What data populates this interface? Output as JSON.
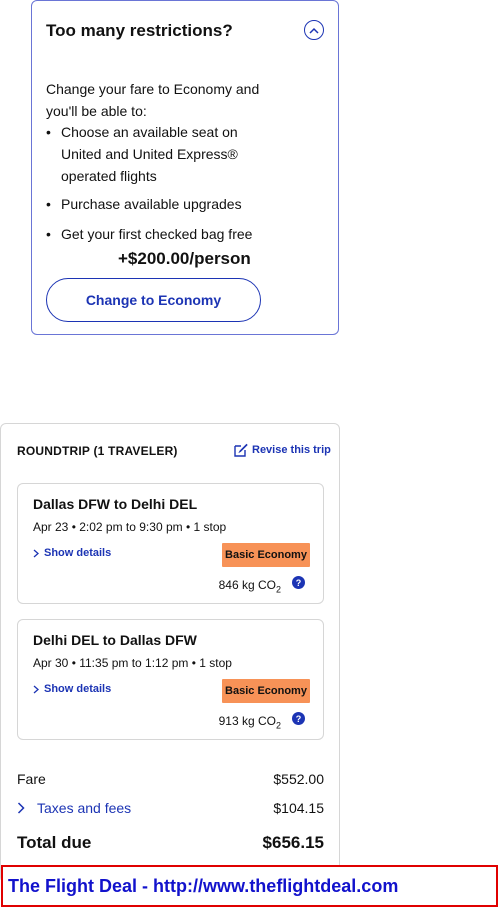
{
  "upsell": {
    "title": "Too many restrictions?",
    "intro": "Change your fare to Economy and you'll be able to:",
    "benefits": [
      "Choose an available seat on United and United Express® operated flights",
      "Purchase available upgrades",
      "Get your first checked bag free"
    ],
    "price": "+$200.00/person",
    "button_label": "Change to Economy"
  },
  "trip": {
    "header": "ROUNDTRIP (1 TRAVELER)",
    "revise_label": "Revise this trip",
    "segments": [
      {
        "route": "Dallas DFW to Delhi DEL",
        "time": "Apr 23 • 2:02 pm to 9:30 pm • 1 stop",
        "details_label": "Show details",
        "fare_class": "Basic Economy",
        "co2_value": "846 kg CO",
        "co2_sub": "2"
      },
      {
        "route": "Delhi DEL to Dallas DFW",
        "time": "Apr 30 • 11:35 pm to 1:12 pm • 1 stop",
        "details_label": "Show details",
        "fare_class": "Basic Economy",
        "co2_value": "913 kg CO",
        "co2_sub": "2"
      }
    ],
    "fare_label": "Fare",
    "fare_value": "$552.00",
    "taxes_label": "Taxes and fees",
    "taxes_value": "$104.15",
    "total_label": "Total due",
    "total_value": "$656.15"
  },
  "banner": {
    "text": "The Flight Deal - http://www.theflightdeal.com"
  },
  "colors": {
    "link_blue": "#1c34b4",
    "badge_orange": "#f79257",
    "banner_red": "#e00000",
    "banner_text": "#1212cc"
  },
  "icons": {
    "collapse": "chevron-up-icon",
    "revise": "edit-icon",
    "details": "chevron-right-icon",
    "info": "question-icon"
  }
}
